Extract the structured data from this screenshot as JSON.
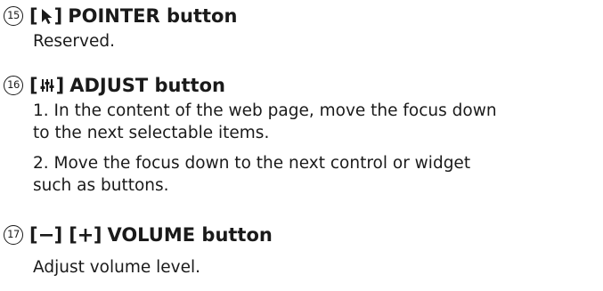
{
  "items": [
    {
      "number": "15",
      "icon": "pointer-arrow-icon",
      "label": "POINTER button",
      "description": [
        "Reserved."
      ]
    },
    {
      "number": "16",
      "icon": "adjust-sliders-icon",
      "label": "ADJUST button",
      "description": [
        "1. In the content of the web page, move the focus down",
        "to the next selectable items.",
        "2. Move the focus down to the next control or widget",
        "such as buttons."
      ]
    },
    {
      "number": "17",
      "icons": [
        "minus-icon",
        "plus-icon"
      ],
      "label": "VOLUME button",
      "description": [
        "Adjust volume level."
      ]
    }
  ]
}
